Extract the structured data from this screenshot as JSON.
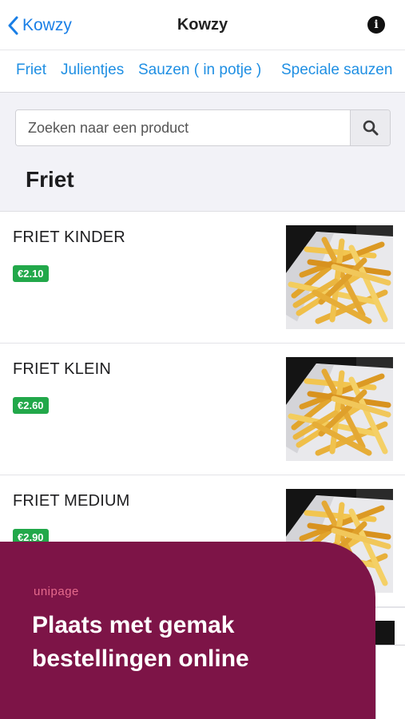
{
  "header": {
    "back_label": "Kowzy",
    "title": "Kowzy",
    "info_glyph": "i"
  },
  "tabs": [
    {
      "label": "Friet"
    },
    {
      "label": "Julientjes"
    },
    {
      "label": "Sauzen ( in potje )"
    },
    {
      "label": "Speciale sauzen"
    }
  ],
  "search": {
    "placeholder": "Zoeken naar een product",
    "icon": "search-icon"
  },
  "section": {
    "title": "Friet"
  },
  "products": [
    {
      "name": "FRIET KINDER",
      "price": "€2.10",
      "image": "fries-image"
    },
    {
      "name": "FRIET KLEIN",
      "price": "€2.60",
      "image": "fries-image"
    },
    {
      "name": "FRIET MEDIUM",
      "price": "€2.90",
      "image": "fries-image"
    }
  ],
  "promo": {
    "brand": "unipage",
    "headline": "Plaats met gemak bestellingen online"
  },
  "colors": {
    "accent": "#1a7fe6",
    "price_badge": "#22a84a",
    "promo_background": "#7d1447",
    "brand_text": "#e56a8c"
  }
}
